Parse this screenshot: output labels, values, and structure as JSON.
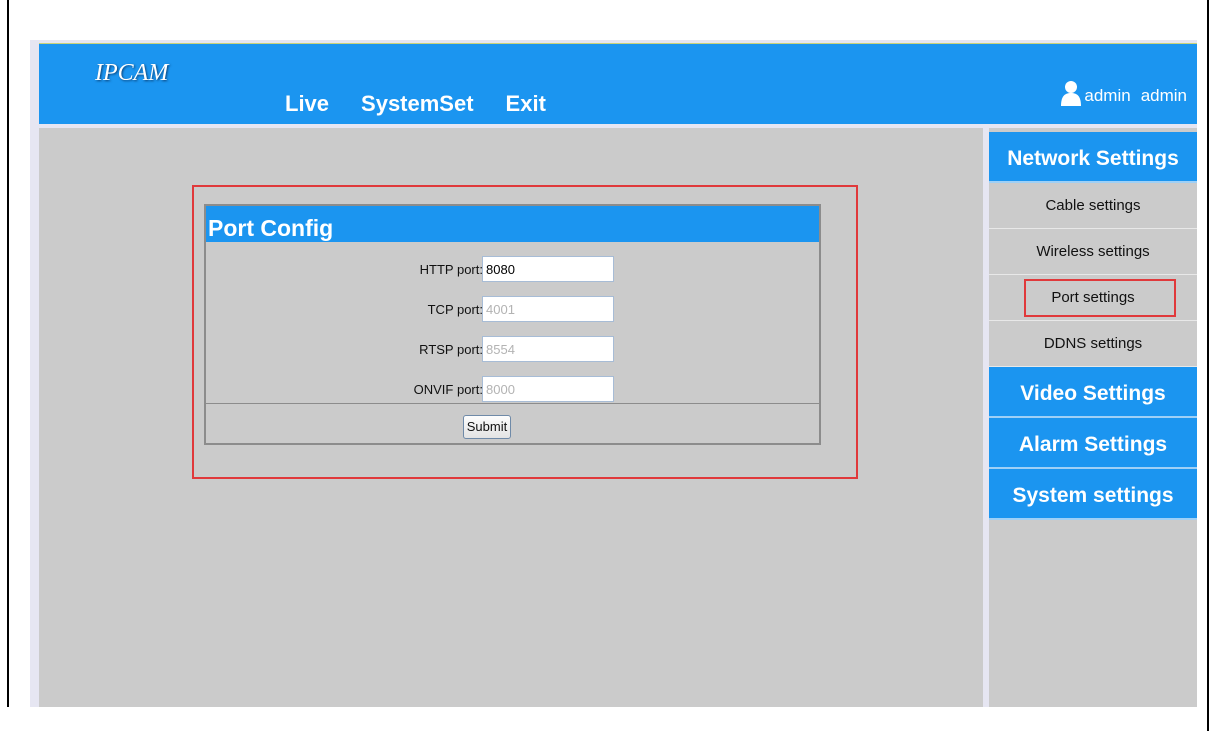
{
  "header": {
    "logo": "IPCAM",
    "nav": [
      "Live",
      "SystemSet",
      "Exit"
    ],
    "user_name_1": "admin",
    "user_name_2": "admin"
  },
  "port_config": {
    "title": "Port Config",
    "fields": [
      {
        "label": "HTTP port:",
        "value": "8080",
        "disabled": false
      },
      {
        "label": "TCP port:",
        "value": "4001",
        "disabled": true
      },
      {
        "label": "RTSP port:",
        "value": "8554",
        "disabled": true
      },
      {
        "label": "ONVIF port:",
        "value": "8000",
        "disabled": true
      }
    ],
    "submit_label": "Submit"
  },
  "sidebar": {
    "network_title": "Network Settings",
    "network_items": [
      "Cable settings",
      "Wireless settings",
      "Port settings",
      "DDNS settings"
    ],
    "video_title": "Video Settings",
    "alarm_title": "Alarm Settings",
    "system_title": "System settings"
  },
  "colors": {
    "accent": "#1b95f0",
    "highlight": "#e0393b"
  }
}
